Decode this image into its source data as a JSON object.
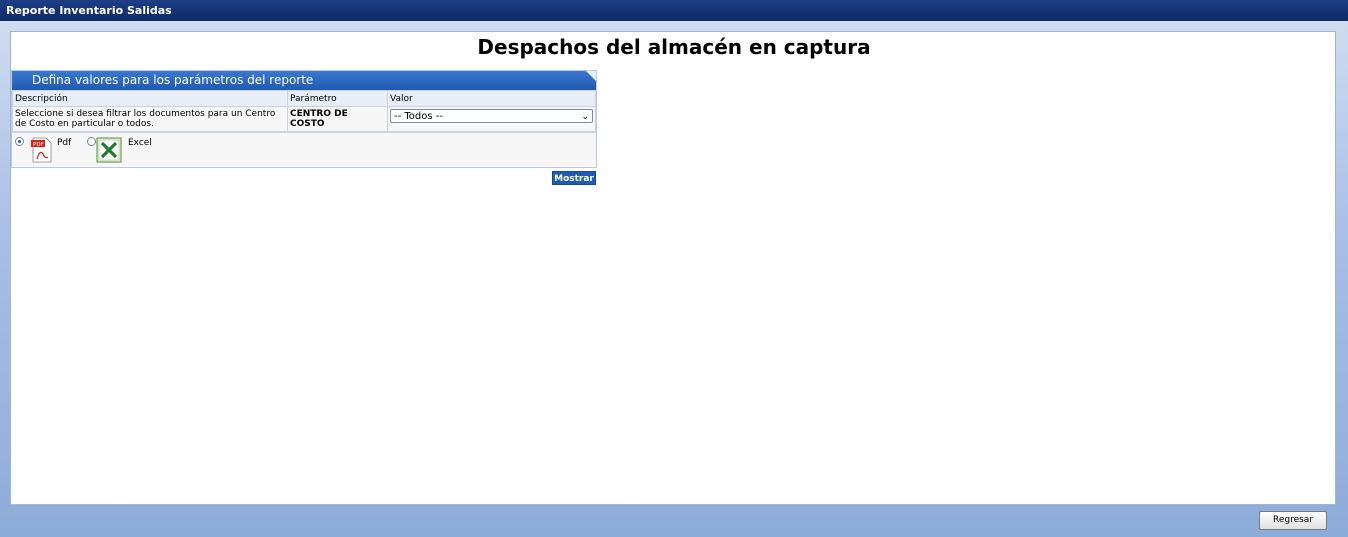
{
  "window": {
    "title": "Reporte Inventario Salidas"
  },
  "page": {
    "title": "Despachos del almacén en captura"
  },
  "params": {
    "header": "Defina valores para los parámetros del reporte",
    "columns": [
      "Descripción",
      "Parámetro",
      "Valor"
    ],
    "rows": [
      {
        "description": "Seleccione si desea filtrar los documentos para un Centro de Costo en particular o todos.",
        "parameter": "CENTRO DE COSTO",
        "value": "-- Todos --"
      }
    ],
    "formats": [
      {
        "label": "Pdf",
        "icon": "pdf-icon",
        "selected": true
      },
      {
        "label": "Excel",
        "icon": "excel-icon",
        "selected": false
      }
    ],
    "submit_label": "Mostrar"
  },
  "footer": {
    "back_label": "Regresar"
  },
  "colors": {
    "titlebar": "#14347a",
    "accent": "#1f5bb0",
    "background": "#8eacd9"
  }
}
